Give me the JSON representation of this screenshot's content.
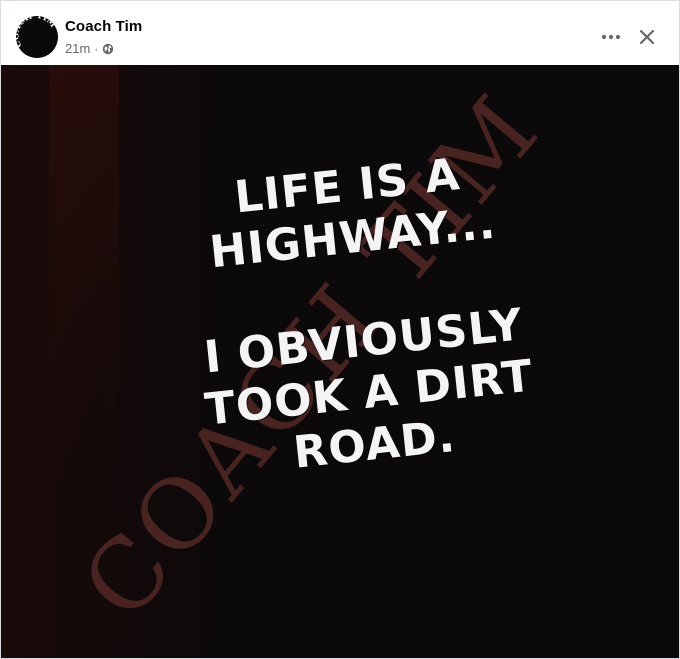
{
  "post": {
    "author": "Coach Tim",
    "timestamp": "21m",
    "separator": "·",
    "privacy_icon": "globe-icon",
    "avatar_text": "COACH TIM",
    "more_icon": "more-horizontal-icon",
    "close_icon": "close-icon"
  },
  "image": {
    "watermark": "COACH TIM",
    "quote_lines": [
      "LIFE IS A",
      "HIGHWAY...",
      "I OBVIOUSLY",
      "TOOK A DIRT",
      "ROAD."
    ],
    "colors": {
      "background": "#0b090a",
      "text": "#f4f4f4",
      "watermark": "#5a2a26"
    }
  }
}
